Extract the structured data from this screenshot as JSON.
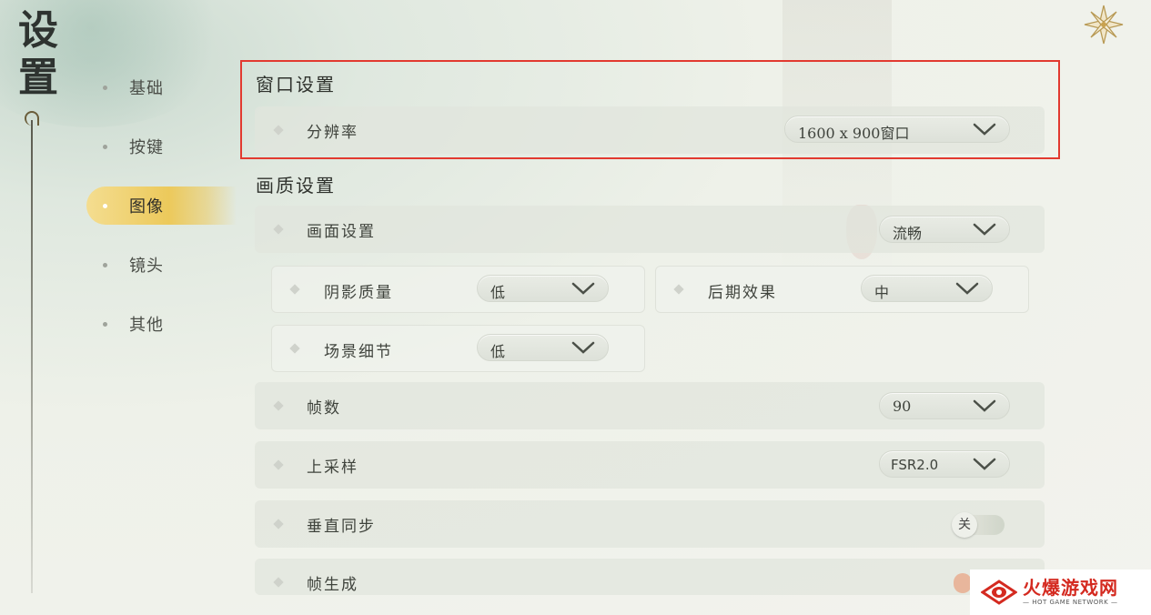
{
  "page": {
    "title": "设置"
  },
  "sidebar": {
    "items": [
      {
        "label": "基础",
        "active": false
      },
      {
        "label": "按键",
        "active": false
      },
      {
        "label": "图像",
        "active": true
      },
      {
        "label": "镜头",
        "active": false
      },
      {
        "label": "其他",
        "active": false
      }
    ]
  },
  "window_section": {
    "title": "窗口设置",
    "resolution": {
      "label": "分辨率",
      "value": "1600 x 900窗口"
    }
  },
  "quality_section": {
    "title": "画质设置",
    "preset": {
      "label": "画面设置",
      "value": "流畅"
    },
    "shadow": {
      "label": "阴影质量",
      "value": "低"
    },
    "post": {
      "label": "后期效果",
      "value": "中"
    },
    "scene": {
      "label": "场景细节",
      "value": "低"
    },
    "fps": {
      "label": "帧数",
      "value": "90"
    },
    "upscale": {
      "label": "上采样",
      "value": "FSR2.0"
    },
    "vsync": {
      "label": "垂直同步",
      "value": "关"
    },
    "framegen": {
      "label": "帧生成"
    }
  },
  "watermark": {
    "main": "火爆游戏网",
    "sub": "— HOT GAME NETWORK —"
  },
  "colors": {
    "accent": "#ecc95b",
    "highlight_border": "#e23a30",
    "watermark_red": "#d42a20"
  },
  "icons": {
    "ornament": "flower-star-icon",
    "dropdown": "chevron-down-icon"
  }
}
